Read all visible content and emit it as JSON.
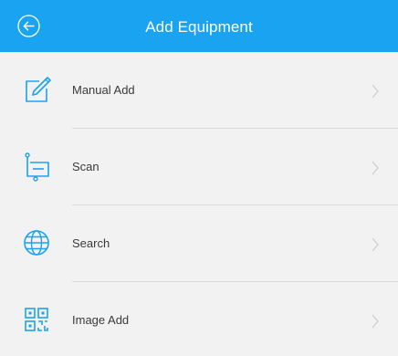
{
  "header": {
    "title": "Add Equipment",
    "back_icon": "back-arrow-circle-icon",
    "background": "#1aa3f0"
  },
  "menu": {
    "items": [
      {
        "label": "Manual Add",
        "icon": "edit-square-icon"
      },
      {
        "label": "Scan",
        "icon": "scan-frame-icon"
      },
      {
        "label": "Search",
        "icon": "globe-icon"
      },
      {
        "label": "Image Add",
        "icon": "qr-code-icon"
      }
    ],
    "accent": "#1aa3f0",
    "chevron_icon": "chevron-right-icon"
  }
}
